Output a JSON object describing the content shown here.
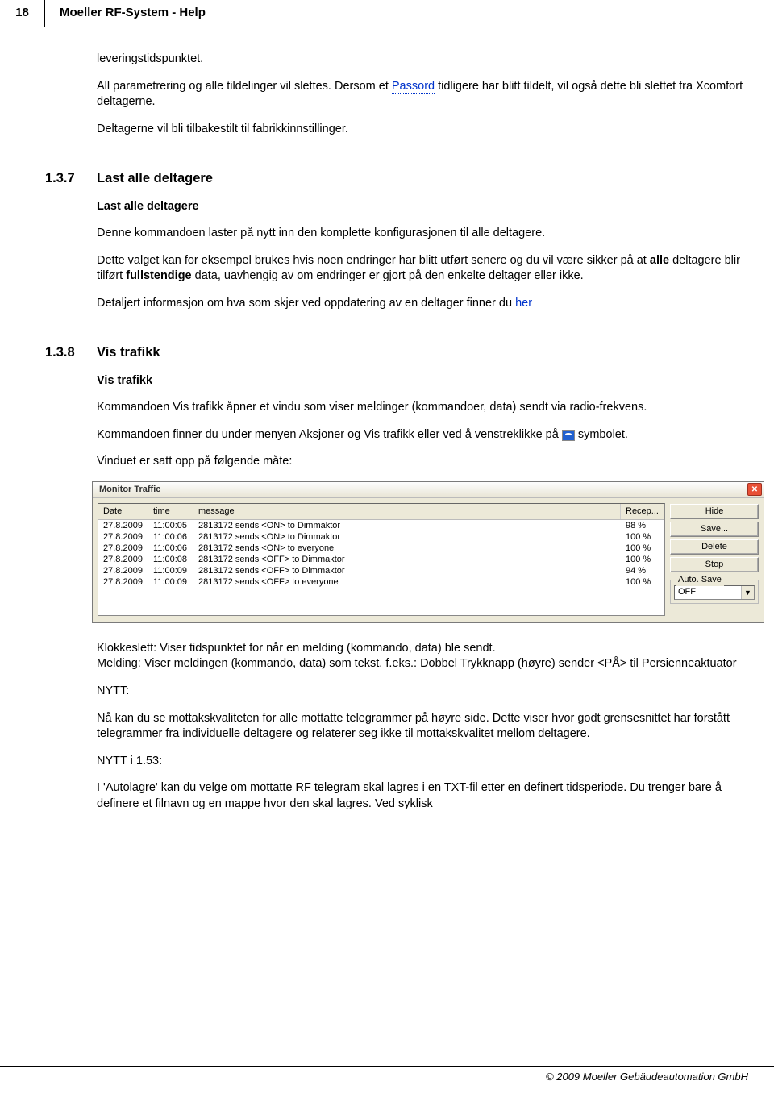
{
  "header": {
    "page_number": "18",
    "title": "Moeller RF-System - Help"
  },
  "intro": {
    "p1": "leveringstidspunktet.",
    "p2a": "All parametrering og alle tildelinger vil slettes. Dersom et ",
    "p2_link": "Passord",
    "p2b": " tidligere har blitt tildelt, vil også dette bli slettet fra Xcomfort deltagerne.",
    "p3": "Deltagerne vil bli tilbakestilt til fabrikkinnstillinger."
  },
  "s137": {
    "num": "1.3.7",
    "title": "Last alle deltagere",
    "sub": "Last alle deltagere",
    "p1": "Denne kommandoen laster på nytt inn den komplette konfigurasjonen til alle deltagere.",
    "p2a": "Dette valget kan for eksempel brukes hvis noen endringer har blitt utført senere og du vil være sikker på at ",
    "p2_b1": "alle",
    "p2b": " deltagere blir tilført ",
    "p2_b2": "fullstendige",
    "p2c": " data, uavhengig av om endringer er gjort på den enkelte deltager eller ikke.",
    "p3a": "Detaljert informasjon om hva som skjer ved oppdatering av en deltager finner du ",
    "p3_link": "her"
  },
  "s138": {
    "num": "1.3.8",
    "title": "Vis trafikk",
    "sub": "Vis trafikk",
    "p1": "Kommandoen Vis trafikk åpner et vindu som viser meldinger (kommandoer, data) sendt via radio-frekvens.",
    "p2a": "Kommandoen finner du under menyen Aksjoner og Vis trafikk eller ved å venstreklikke på ",
    "p2b": " symbolet.",
    "p3": "Vinduet er satt opp på følgende måte:"
  },
  "window": {
    "title": "Monitor Traffic",
    "columns": {
      "date": "Date",
      "time": "time",
      "message": "message",
      "recep": "Recep..."
    },
    "rows": [
      {
        "date": "27.8.2009",
        "time": "11:00:05",
        "msg": "2813172 sends <ON> to Dimmaktor",
        "recep": "98 %"
      },
      {
        "date": "27.8.2009",
        "time": "11:00:06",
        "msg": "2813172 sends <ON> to Dimmaktor",
        "recep": "100 %"
      },
      {
        "date": "27.8.2009",
        "time": "11:00:06",
        "msg": "2813172 sends <ON> to everyone",
        "recep": "100 %"
      },
      {
        "date": "27.8.2009",
        "time": "11:00:08",
        "msg": "2813172 sends <OFF> to Dimmaktor",
        "recep": "100 %"
      },
      {
        "date": "27.8.2009",
        "time": "11:00:09",
        "msg": "2813172 sends <OFF> to Dimmaktor",
        "recep": "94 %"
      },
      {
        "date": "27.8.2009",
        "time": "11:00:09",
        "msg": "2813172 sends <OFF> to everyone",
        "recep": "100 %"
      }
    ],
    "buttons": {
      "hide": "Hide",
      "save": "Save...",
      "delete": "Delete",
      "stop": "Stop"
    },
    "autosave": {
      "legend": "Auto. Save",
      "value": "OFF"
    }
  },
  "after": {
    "p1": "Klokkeslett: Viser tidspunktet for når en melding (kommando, data) ble sendt.",
    "p2": "Melding: Viser meldingen (kommando, data) som tekst, f.eks.: Dobbel Trykknapp (høyre) sender <PÅ> til Persienneaktuator",
    "p3": "NYTT:",
    "p4": "Nå kan du se mottakskvaliteten for alle mottatte telegrammer på høyre side. Dette viser hvor godt grensesnittet har forstått telegrammer fra individuelle deltagere og relaterer seg ikke til mottakskvalitet mellom deltagere.",
    "p5": "NYTT i 1.53:",
    "p6": "I 'Autolagre' kan du velge om mottatte RF telegram skal lagres i en TXT-fil etter en definert tidsperiode. Du trenger bare å definere et filnavn og en mappe hvor den skal lagres. Ved syklisk"
  },
  "footer": "© 2009 Moeller Gebäudeautomation GmbH"
}
